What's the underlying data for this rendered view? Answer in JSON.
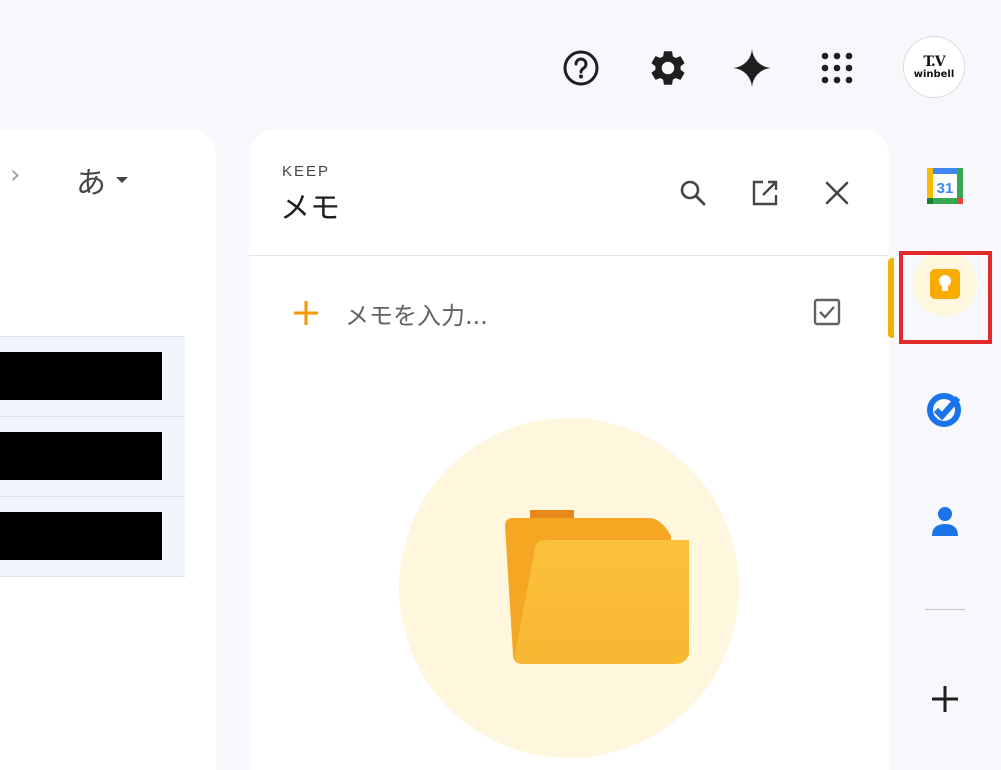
{
  "header": {
    "icons": [
      "help-icon",
      "settings-icon",
      "gemini-sparkle-icon",
      "apps-grid-icon"
    ],
    "avatar": {
      "logo_mark": "T.V",
      "logo_text": "winbell"
    }
  },
  "main": {
    "nav_next_glyph": "›",
    "input_tool_label": "あ",
    "rows_count_visible": 3
  },
  "keep": {
    "eyebrow": "KEEP",
    "title": "メモ",
    "note_placeholder": "メモを入力...",
    "icons": [
      "search-icon",
      "open-in-new-icon",
      "close-icon",
      "plus-icon",
      "checkbox-icon",
      "folder-icon"
    ]
  },
  "rail": {
    "apps": [
      "calendar",
      "keep",
      "tasks",
      "contacts"
    ],
    "calendar_day": "31",
    "add_glyph": "+",
    "active": "keep"
  },
  "colors": {
    "background": "#f6f8fc",
    "panel": "#ffffff",
    "keep_accent": "#f2b200",
    "keep_soft": "#fef6dd",
    "highlight": "#e3282b",
    "tasks_blue": "#1a73e8"
  }
}
